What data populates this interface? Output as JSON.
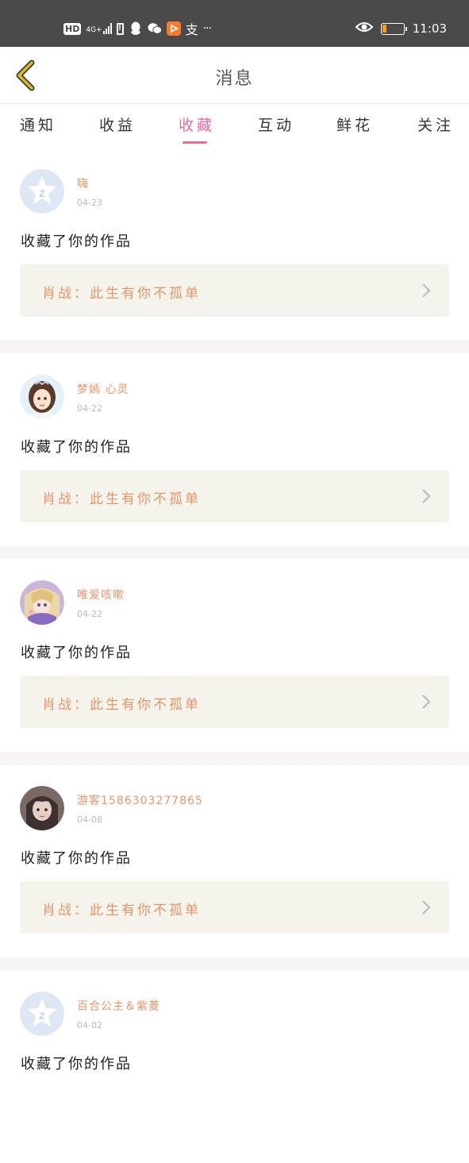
{
  "status_bar": {
    "hd": "HD",
    "network": "4G+",
    "time": "11:03",
    "battery_level": 0.2,
    "battery_color": "#ff9a1f",
    "icons": [
      "hd-icon",
      "signal-icon",
      "alert-icon",
      "qq-icon",
      "wechat-icon",
      "video-app-icon",
      "alipay-icon",
      "more-icon",
      "eye-icon",
      "battery-icon"
    ],
    "alipay_glyph": "支",
    "more_glyph": "···"
  },
  "header": {
    "title": "消息",
    "back_icon": "chevron-left-icon",
    "back_color": "#e0b820"
  },
  "tabs": [
    {
      "label": "通知",
      "active": false
    },
    {
      "label": "收益",
      "active": false
    },
    {
      "label": "收藏",
      "active": true
    },
    {
      "label": "互动",
      "active": false
    },
    {
      "label": "鲜花",
      "active": false
    },
    {
      "label": "关注",
      "active": false
    }
  ],
  "accent_color": "#e36aa1",
  "feed": [
    {
      "username": "嗨",
      "date": "04-23",
      "action": "收藏了你的作品",
      "work": "肖战：此生有你不孤单",
      "avatar": "default-avatar"
    },
    {
      "username": "梦嫣 心灵",
      "date": "04-22",
      "action": "收藏了你的作品",
      "work": "肖战：此生有你不孤单",
      "avatar": "girl-avatar"
    },
    {
      "username": "唯爱咳嗽",
      "date": "04-22",
      "action": "收藏了你的作品",
      "work": "肖战：此生有你不孤单",
      "avatar": "anime-avatar"
    },
    {
      "username": "游客15863032778​65",
      "date": "04-08",
      "action": "收藏了你的作品",
      "work": "肖战：此生有你不孤单",
      "avatar": "photo-avatar"
    },
    {
      "username": "百合公主＆紫菱",
      "date": "04-02",
      "action": "收藏了你的作品",
      "work": "",
      "avatar": "default-avatar"
    }
  ]
}
